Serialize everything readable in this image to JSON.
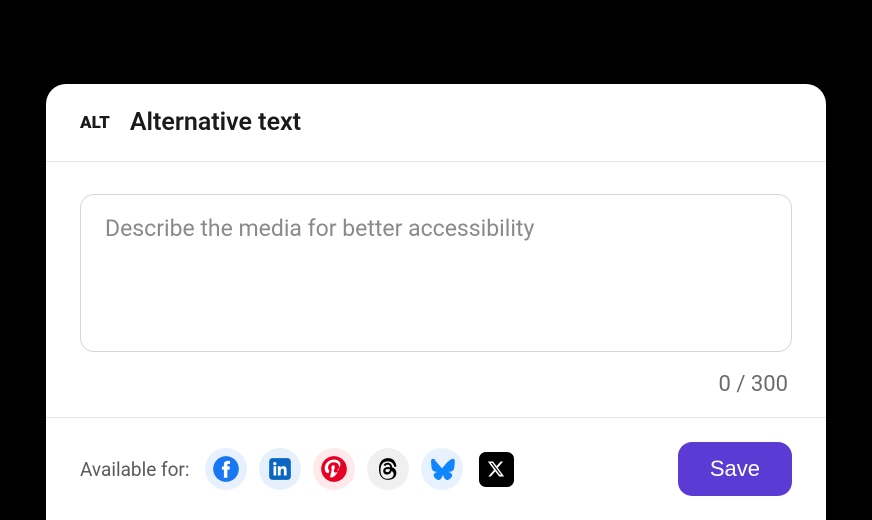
{
  "header": {
    "badge": "ALT",
    "title": "Alternative text"
  },
  "body": {
    "placeholder": "Describe the media for better accessibility",
    "value": "",
    "counter": "0 / 300"
  },
  "footer": {
    "available_label": "Available for:",
    "platforms": [
      "facebook",
      "linkedin",
      "pinterest",
      "threads",
      "bluesky",
      "x"
    ],
    "save_label": "Save"
  }
}
